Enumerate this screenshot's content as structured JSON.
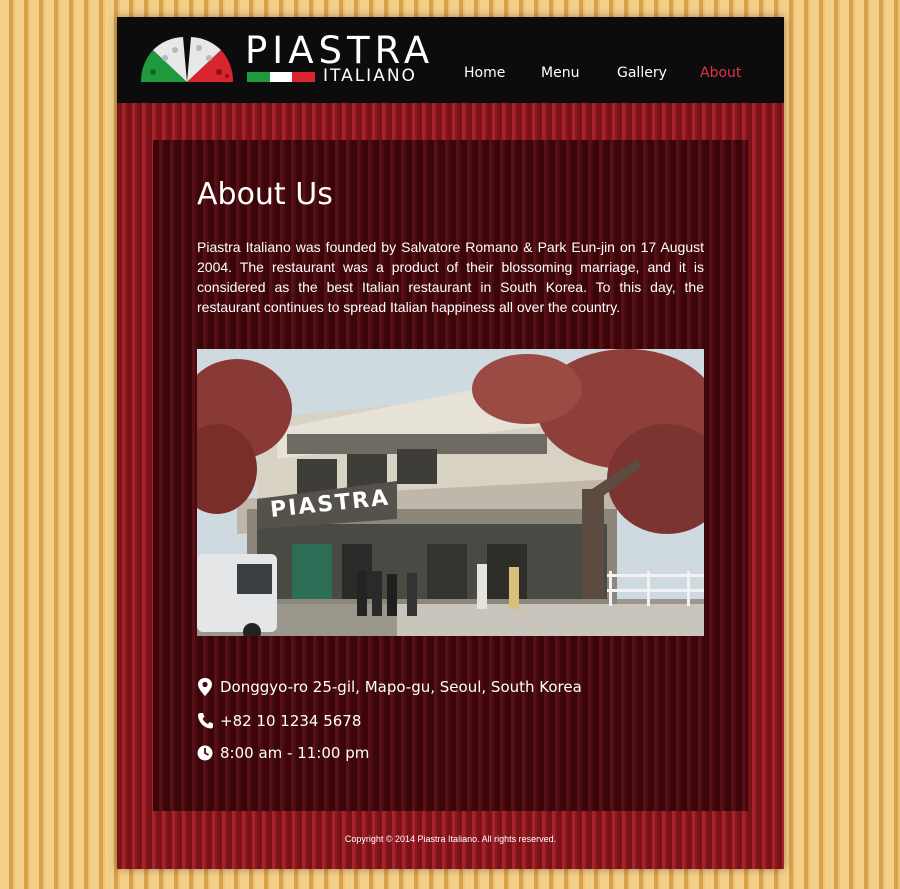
{
  "brand": {
    "name": "PIASTRA",
    "subtitle": "ITALIANO",
    "flag_colors": [
      "#1e9a3c",
      "#ffffff",
      "#d9262e"
    ]
  },
  "nav": {
    "items": [
      {
        "label": "Home",
        "active": false
      },
      {
        "label": "Menu",
        "active": false
      },
      {
        "label": "Gallery",
        "active": false
      },
      {
        "label": "About",
        "active": true
      }
    ]
  },
  "main": {
    "title": "About Us",
    "intro": "Piastra Italiano was founded by Salvatore Romano & Park Eun-jin on 17 August 2004. The restaurant was a product of their blossoming marriage, and it is considered as the best Italian restaurant in South Korea. To this day, the restaurant continues to spread Italian happiness all over the country.",
    "photo": {
      "sign_text": "PIASTRA"
    },
    "contact": {
      "address": "Donggyo-ro 25-gil, Mapo-gu, Seoul, South Korea",
      "phone": "+82 10 1234 5678",
      "hours": "8:00 am - 11:00 pm",
      "icons": [
        "map-pin-icon",
        "phone-icon",
        "clock-icon"
      ]
    }
  },
  "footer": {
    "copyright": "Copyright © 2014 Piastra Italiano. All rights reserved."
  },
  "colors": {
    "accent": "#e0334a",
    "header_bg": "#0c0c0c",
    "stripe_red": "#a8242c",
    "panel_dark": "#3c0609",
    "page_stripe": "#f3cf8a"
  }
}
